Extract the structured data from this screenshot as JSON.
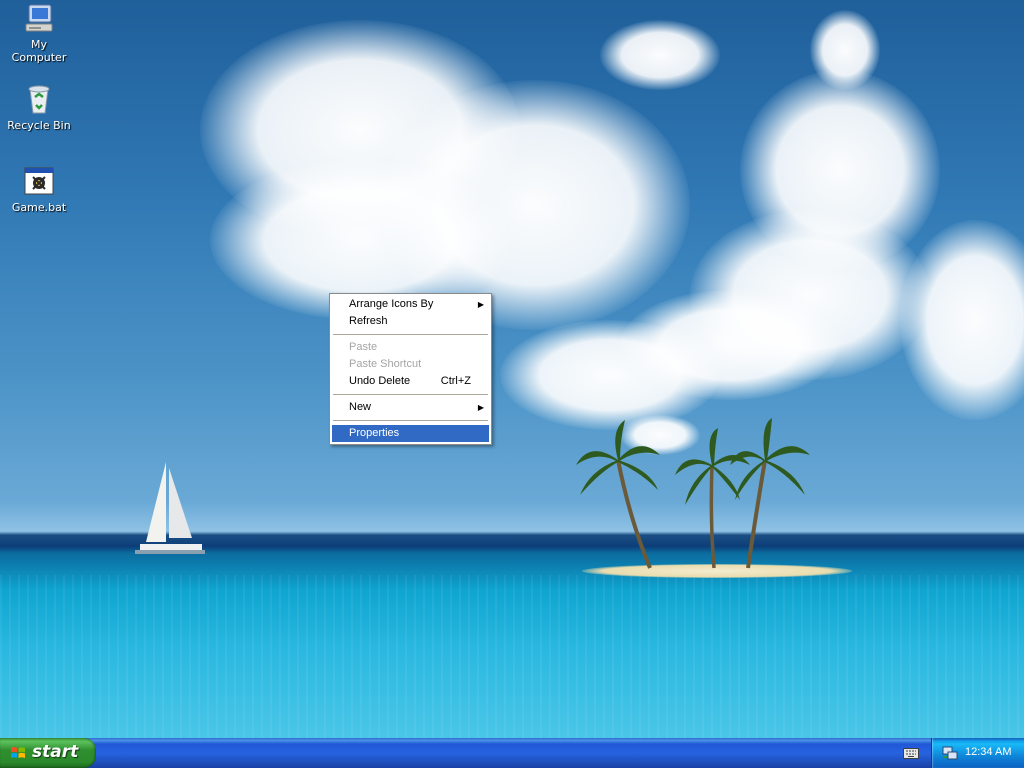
{
  "desktop": {
    "icons": [
      {
        "label": "My Computer",
        "icon": "my-computer-icon"
      },
      {
        "label": "Recycle Bin",
        "icon": "recycle-bin-icon"
      },
      {
        "label": "Game.bat",
        "icon": "batch-file-icon"
      }
    ]
  },
  "context_menu": {
    "items": [
      {
        "label": "Arrange Icons By",
        "submenu": true,
        "enabled": true
      },
      {
        "label": "Refresh",
        "enabled": true
      },
      {
        "label": "Paste",
        "enabled": false
      },
      {
        "label": "Paste Shortcut",
        "enabled": false
      },
      {
        "label": "Undo Delete",
        "shortcut": "Ctrl+Z",
        "enabled": true
      },
      {
        "label": "New",
        "submenu": true,
        "enabled": true
      },
      {
        "label": "Properties",
        "enabled": true,
        "highlighted": true
      }
    ]
  },
  "taskbar": {
    "start_label": "start",
    "tray": {
      "clock": "12:34 AM",
      "icons": [
        "keyboard-icon",
        "network-icon"
      ]
    }
  },
  "colors": {
    "taskbar_blue": "#2663e0",
    "start_green": "#2f8f2f",
    "menu_highlight": "#316ac5",
    "disabled_text": "#a5a5a5"
  }
}
